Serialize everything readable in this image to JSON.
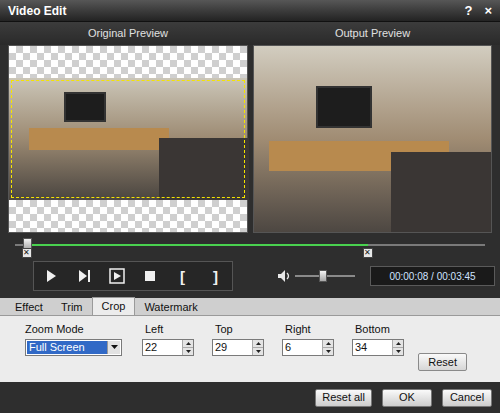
{
  "window": {
    "title": "Video Edit",
    "buttons": [
      "?",
      "×"
    ]
  },
  "previews": [
    {
      "label": "Original Preview"
    },
    {
      "label": "Output Preview"
    }
  ],
  "timeline": {
    "level": 0.025,
    "markers": [
      {
        "glyph": "✕",
        "level": 0.025
      },
      {
        "glyph": "✕",
        "level": 0.75
      }
    ]
  },
  "controls": [
    {
      "kind": "play"
    },
    {
      "kind": "next"
    },
    {
      "kind": "step"
    },
    {
      "kind": "stop"
    },
    {
      "kind": "text",
      "label": "["
    },
    {
      "kind": "text",
      "label": "]"
    }
  ],
  "volume": {
    "level": 0.47
  },
  "time": "00:00:08 / 00:03:45",
  "tabs": [
    {
      "label": "Effect",
      "selected": false
    },
    {
      "label": "Trim",
      "selected": false
    },
    {
      "label": "Crop",
      "selected": true
    },
    {
      "label": "Watermark",
      "selected": false
    }
  ],
  "crop": {
    "zoom_mode": {
      "label": "Zoom Mode",
      "value": "Full Screen"
    },
    "fields": [
      {
        "label": "Left",
        "value": "22"
      },
      {
        "label": "Top",
        "value": "29"
      },
      {
        "label": "Right",
        "value": "6"
      },
      {
        "label": "Bottom",
        "value": "34"
      }
    ],
    "reset": "Reset"
  },
  "buttons": [
    "Reset all",
    "OK",
    "Cancel"
  ]
}
